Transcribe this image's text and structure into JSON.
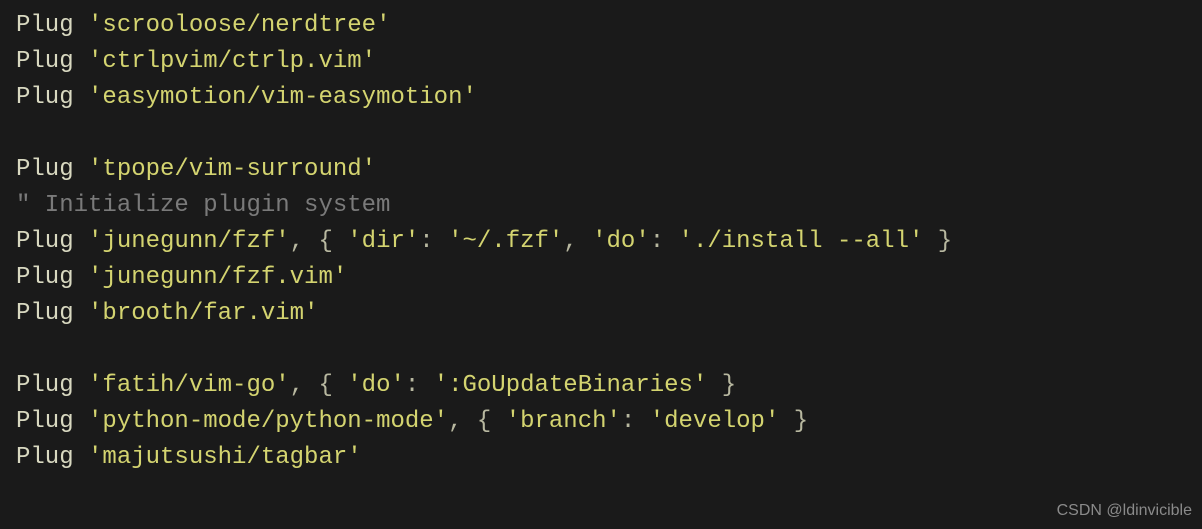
{
  "code": {
    "lines": [
      {
        "type": "plug",
        "keyword": "Plug",
        "arg": "'scrooloose/nerdtree'"
      },
      {
        "type": "plug",
        "keyword": "Plug",
        "arg": "'ctrlpvim/ctrlp.vim'"
      },
      {
        "type": "plug",
        "keyword": "Plug",
        "arg": "'easymotion/vim-easymotion'"
      },
      {
        "type": "blank"
      },
      {
        "type": "plug",
        "keyword": "Plug",
        "arg": "'tpope/vim-surround'"
      },
      {
        "type": "comment",
        "text": "\" Initialize plugin system"
      },
      {
        "type": "plug_opts",
        "keyword": "Plug",
        "arg": "'junegunn/fzf'",
        "sep1": ", { ",
        "key1": "'dir'",
        "colon1": ": ",
        "val1": "'~/.fzf'",
        "sep2": ", ",
        "key2": "'do'",
        "colon2": ": ",
        "val2": "'./install --all'",
        "close": " }"
      },
      {
        "type": "plug",
        "keyword": "Plug",
        "arg": "'junegunn/fzf.vim'"
      },
      {
        "type": "plug",
        "keyword": "Plug",
        "arg": "'brooth/far.vim'"
      },
      {
        "type": "blank"
      },
      {
        "type": "plug_opts1",
        "keyword": "Plug",
        "arg": "'fatih/vim-go'",
        "sep1": ", { ",
        "key1": "'do'",
        "colon1": ": ",
        "val1": "':GoUpdateBinaries'",
        "close": " }"
      },
      {
        "type": "plug_opts1",
        "keyword": "Plug",
        "arg": "'python-mode/python-mode'",
        "sep1": ", { ",
        "key1": "'branch'",
        "colon1": ": ",
        "val1": "'develop'",
        "close": " }"
      },
      {
        "type": "plug",
        "keyword": "Plug",
        "arg": "'majutsushi/tagbar'"
      }
    ]
  },
  "watermark": "CSDN @ldinvicible"
}
